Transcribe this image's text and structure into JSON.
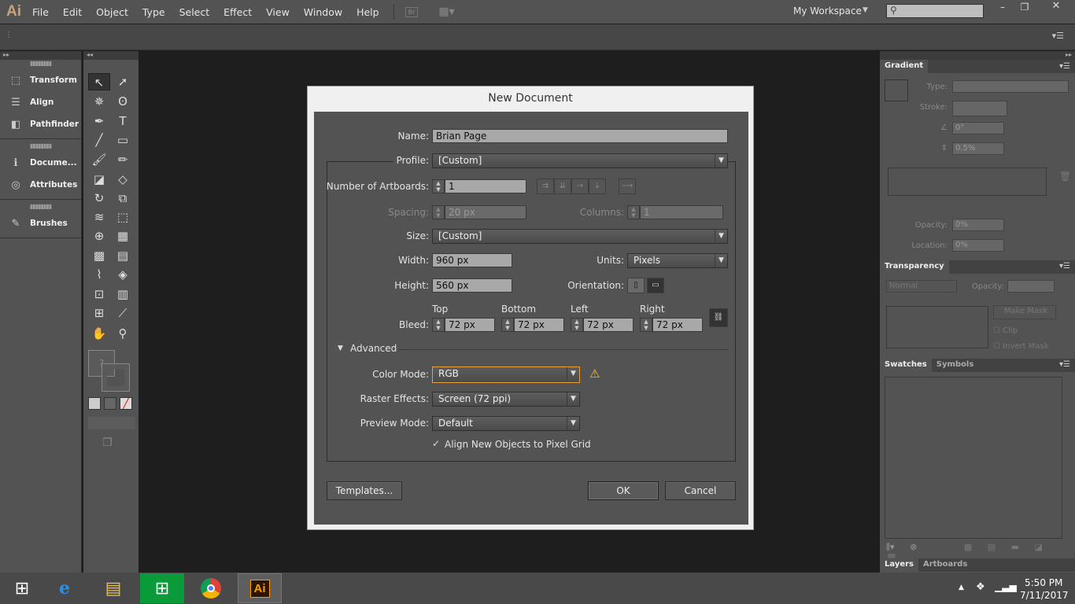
{
  "app": {
    "logo": "Ai",
    "menus": [
      "File",
      "Edit",
      "Object",
      "Type",
      "Select",
      "Effect",
      "View",
      "Window",
      "Help"
    ],
    "bridge": "Br",
    "workspace": "My Workspace",
    "search_placeholder": ""
  },
  "left_panel": {
    "items": [
      {
        "label": "Transform",
        "icon": "transform-icon",
        "glyph": "⬚"
      },
      {
        "label": "Align",
        "icon": "align-icon",
        "glyph": "☰"
      },
      {
        "label": "Pathfinder",
        "icon": "pathfinder-icon",
        "glyph": "◧"
      },
      {
        "label": "Docume...",
        "icon": "document-info-icon",
        "glyph": "ℹ"
      },
      {
        "label": "Attributes",
        "icon": "attributes-icon",
        "glyph": "◎"
      },
      {
        "label": "Brushes",
        "icon": "brushes-icon",
        "glyph": "✎"
      }
    ]
  },
  "tools": [
    {
      "name": "selection-tool",
      "g": "↖"
    },
    {
      "name": "direct-selection-tool",
      "g": "➚"
    },
    {
      "name": "magic-wand-tool",
      "g": "✵"
    },
    {
      "name": "lasso-tool",
      "g": "ʘ"
    },
    {
      "name": "pen-tool",
      "g": "✒"
    },
    {
      "name": "type-tool",
      "g": "T"
    },
    {
      "name": "line-tool",
      "g": "╱"
    },
    {
      "name": "rectangle-tool",
      "g": "▭"
    },
    {
      "name": "paintbrush-tool",
      "g": "🖌"
    },
    {
      "name": "pencil-tool",
      "g": "✏"
    },
    {
      "name": "blob-brush-tool",
      "g": "◪"
    },
    {
      "name": "eraser-tool",
      "g": "◇"
    },
    {
      "name": "rotate-tool",
      "g": "↻"
    },
    {
      "name": "scale-tool",
      "g": "⧉"
    },
    {
      "name": "warp-tool",
      "g": "≋"
    },
    {
      "name": "free-transform-tool",
      "g": "⬚"
    },
    {
      "name": "shape-builder-tool",
      "g": "⊕"
    },
    {
      "name": "perspective-grid-tool",
      "g": "▦"
    },
    {
      "name": "mesh-tool",
      "g": "▩"
    },
    {
      "name": "gradient-tool",
      "g": "▤"
    },
    {
      "name": "eyedropper-tool",
      "g": "⌇"
    },
    {
      "name": "blend-tool",
      "g": "◈"
    },
    {
      "name": "symbol-sprayer-tool",
      "g": "⊡"
    },
    {
      "name": "column-graph-tool",
      "g": "▥"
    },
    {
      "name": "artboard-tool",
      "g": "⊞"
    },
    {
      "name": "slice-tool",
      "g": "⟋"
    },
    {
      "name": "hand-tool",
      "g": "✋"
    },
    {
      "name": "zoom-tool",
      "g": "⚲"
    }
  ],
  "gradient_panel": {
    "title": "Gradient",
    "type_label": "Type:",
    "stroke_label": "Stroke:",
    "angle": "0°",
    "aspect": "0.5%",
    "opacity_label": "Opacity:",
    "opacity": "0%",
    "location_label": "Location:",
    "location": "0%"
  },
  "transparency_panel": {
    "title": "Transparency",
    "blend": "Normal",
    "opacity_label": "Opacity:",
    "make_mask": "Make Mask",
    "clip": "Clip",
    "invert_mask": "Invert Mask"
  },
  "swatches_panel": {
    "tabs": [
      "Swatches",
      "Symbols"
    ]
  },
  "layers_panel": {
    "tabs": [
      "Layers",
      "Artboards"
    ]
  },
  "dialog": {
    "title": "New Document",
    "name_label": "Name:",
    "name": "Brian Page",
    "profile_label": "Profile:",
    "profile": "[Custom]",
    "artboards_label": "Number of Artboards:",
    "artboards": "1",
    "spacing_label": "Spacing:",
    "spacing": "20 px",
    "columns_label": "Columns:",
    "columns": "1",
    "size_label": "Size:",
    "size": "[Custom]",
    "width_label": "Width:",
    "width": "960 px",
    "units_label": "Units:",
    "units": "Pixels",
    "height_label": "Height:",
    "height": "560 px",
    "orientation_label": "Orientation:",
    "bleed_label": "Bleed:",
    "bleed": [
      {
        "label": "Top",
        "value": "72 px"
      },
      {
        "label": "Bottom",
        "value": "72 px"
      },
      {
        "label": "Left",
        "value": "72 px"
      },
      {
        "label": "Right",
        "value": "72 px"
      }
    ],
    "advanced_label": "Advanced",
    "color_mode_label": "Color Mode:",
    "color_mode": "RGB",
    "raster_label": "Raster Effects:",
    "raster": "Screen (72 ppi)",
    "preview_label": "Preview Mode:",
    "preview": "Default",
    "pixel_grid_label": "Align New Objects to Pixel Grid",
    "pixel_grid_checked": true,
    "templates": "Templates...",
    "ok": "OK",
    "cancel": "Cancel",
    "warning_color": "#f0c020",
    "focus_color": "#e8a040"
  },
  "taskbar": {
    "time": "5:50 PM",
    "date": "7/11/2017"
  }
}
